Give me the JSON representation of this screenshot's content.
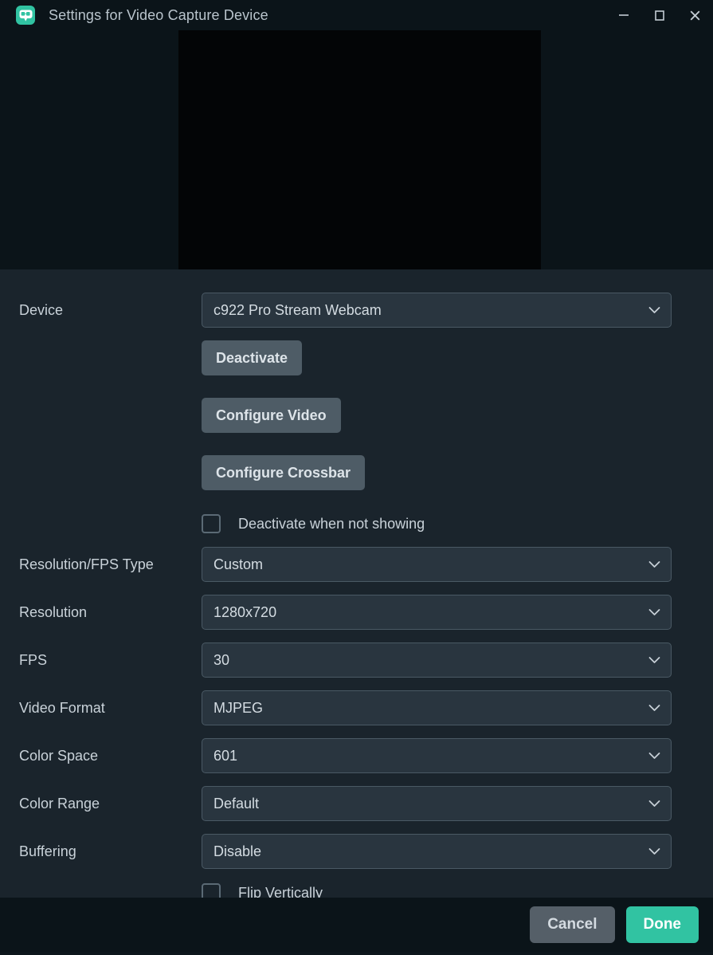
{
  "window": {
    "title": "Settings for Video Capture Device",
    "icon": "streamlabs-robot-icon",
    "controls": {
      "minimize": "minimize-icon",
      "maximize": "maximize-icon",
      "close": "close-icon"
    }
  },
  "preview": {
    "name": "video-preview",
    "state": "black"
  },
  "form": {
    "device": {
      "label": "Device",
      "value": "c922 Pro Stream Webcam"
    },
    "buttons": {
      "deactivate": "Deactivate",
      "configure_video": "Configure Video",
      "configure_crossbar": "Configure Crossbar"
    },
    "deactivate_when_not_showing": {
      "label": "Deactivate when not showing",
      "checked": false
    },
    "resolution_fps_type": {
      "label": "Resolution/FPS Type",
      "value": "Custom"
    },
    "resolution": {
      "label": "Resolution",
      "value": "1280x720"
    },
    "fps": {
      "label": "FPS",
      "value": "30"
    },
    "video_format": {
      "label": "Video Format",
      "value": "MJPEG"
    },
    "color_space": {
      "label": "Color Space",
      "value": "601"
    },
    "color_range": {
      "label": "Color Range",
      "value": "Default"
    },
    "buffering": {
      "label": "Buffering",
      "value": "Disable"
    },
    "flip_vertically": {
      "label": "Flip Vertically",
      "checked": false
    }
  },
  "footer": {
    "cancel": "Cancel",
    "done": "Done"
  },
  "colors": {
    "accent": "#31c3a2",
    "panel": "#1a242c",
    "chrome": "#0b1419",
    "field": "#29353f",
    "field_border": "#4a5964",
    "button": "#4e5c66",
    "text": "#c9d2d9"
  }
}
